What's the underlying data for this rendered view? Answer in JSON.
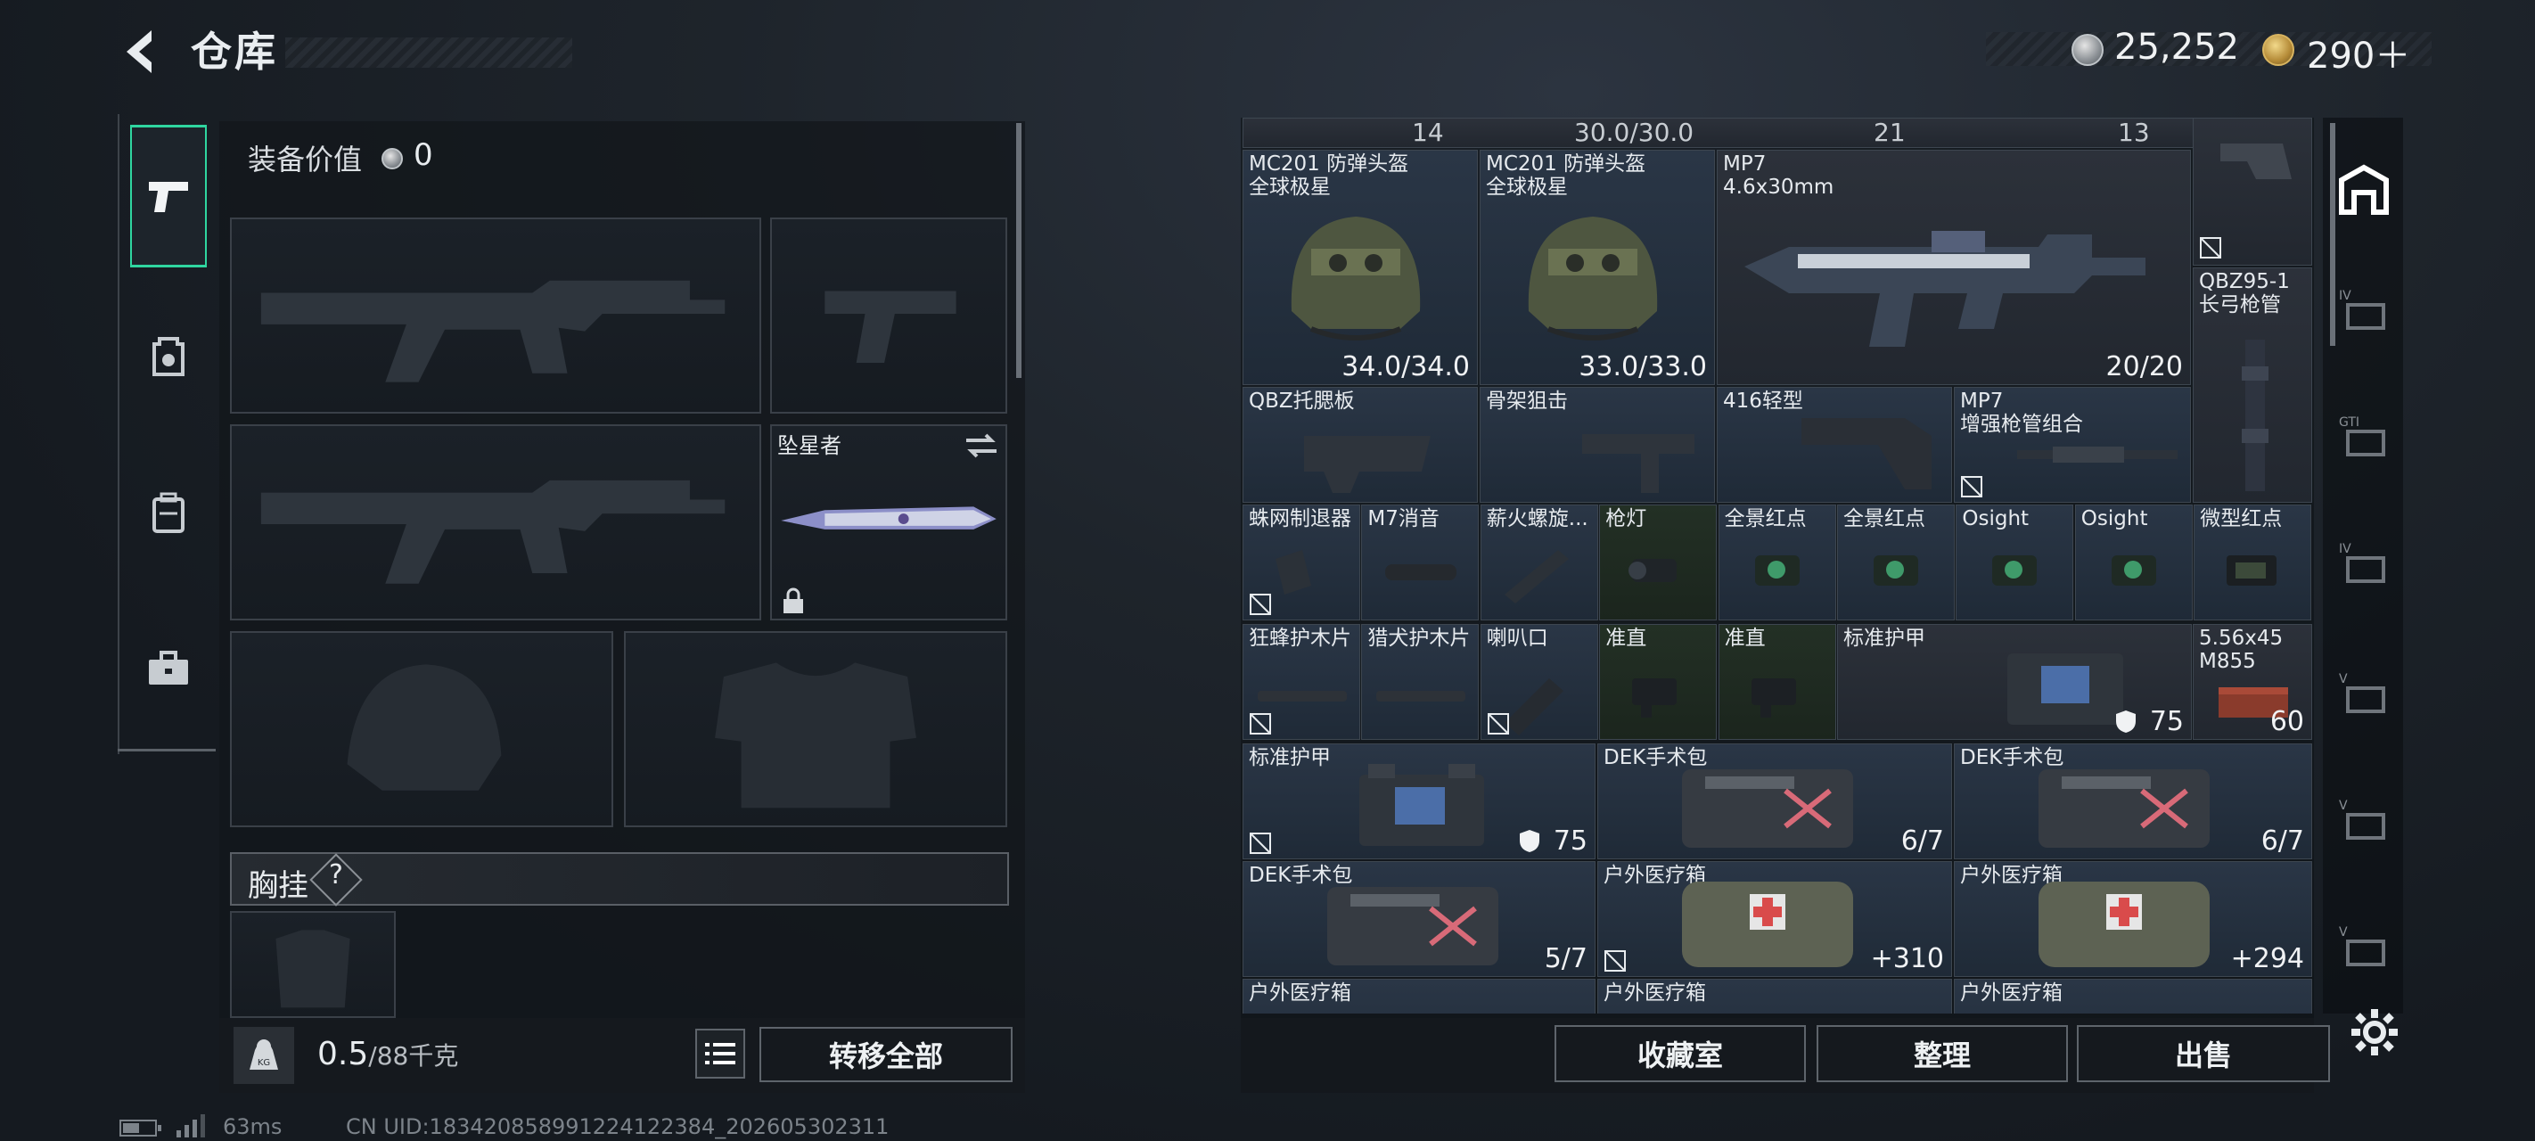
{
  "header": {
    "title": "仓库"
  },
  "currency": {
    "silver": "25,252",
    "gold": "290＋"
  },
  "equip": {
    "value_label": "装备价值",
    "value": "0",
    "melee_name": "坠星者",
    "chest_label": "胸挂",
    "chest_help": "?"
  },
  "weight": {
    "current": "0.5",
    "max": "/88千克"
  },
  "buttons": {
    "transfer_all": "转移全部",
    "collection": "收藏室",
    "organize": "整理",
    "sell": "出售"
  },
  "status": {
    "ping": "63ms",
    "uid": "CN UID:18342085899122412238​4_202605302311"
  },
  "top_row": [
    "14",
    "30.0/30.0",
    "21",
    "13"
  ],
  "items": [
    {
      "name": "MC201 防弹头盔\n全球极星",
      "value": "34.0/34.0"
    },
    {
      "name": "MC201 防弹头盔\n全球极星",
      "value": "33.0/33.0"
    },
    {
      "name": "MP7\n4.6x30mm",
      "value": "20/20"
    },
    {
      "name": "QBZ95-1\n长弓枪管",
      "value": ""
    },
    {
      "name": "QBZ托腮板",
      "value": ""
    },
    {
      "name": "骨架狙击",
      "value": ""
    },
    {
      "name": "416轻型",
      "value": ""
    },
    {
      "name": "MP7\n增强枪管组合",
      "value": ""
    },
    {
      "name": "蛛网制退器",
      "value": ""
    },
    {
      "name": "M7消音",
      "value": ""
    },
    {
      "name": "薪火螺旋...",
      "value": ""
    },
    {
      "name": "枪灯",
      "value": ""
    },
    {
      "name": "全景红点",
      "value": ""
    },
    {
      "name": "全景红点",
      "value": ""
    },
    {
      "name": "Osight",
      "value": ""
    },
    {
      "name": "Osight",
      "value": ""
    },
    {
      "name": "微型红点",
      "value": ""
    },
    {
      "name": "狂蜂护木片",
      "value": ""
    },
    {
      "name": "猎犬护木片",
      "value": ""
    },
    {
      "name": "喇叭口",
      "value": ""
    },
    {
      "name": "准直",
      "value": ""
    },
    {
      "name": "准直",
      "value": ""
    },
    {
      "name": "标准护甲",
      "value": "75"
    },
    {
      "name": "5.56x45\nM855",
      "value": "60"
    },
    {
      "name": "标准护甲",
      "value": "75"
    },
    {
      "name": "DEK手术包",
      "value": "6/7"
    },
    {
      "name": "DEK手术包",
      "value": "6/7"
    },
    {
      "name": "DEK手术包",
      "value": "5/7"
    },
    {
      "name": "户外医疗箱",
      "value": "+310"
    },
    {
      "name": "户外医疗箱",
      "value": "+294"
    },
    {
      "name": "户外医疗箱",
      "value": ""
    },
    {
      "name": "户外医疗箱",
      "value": ""
    },
    {
      "name": "户外医疗箱",
      "value": ""
    }
  ]
}
